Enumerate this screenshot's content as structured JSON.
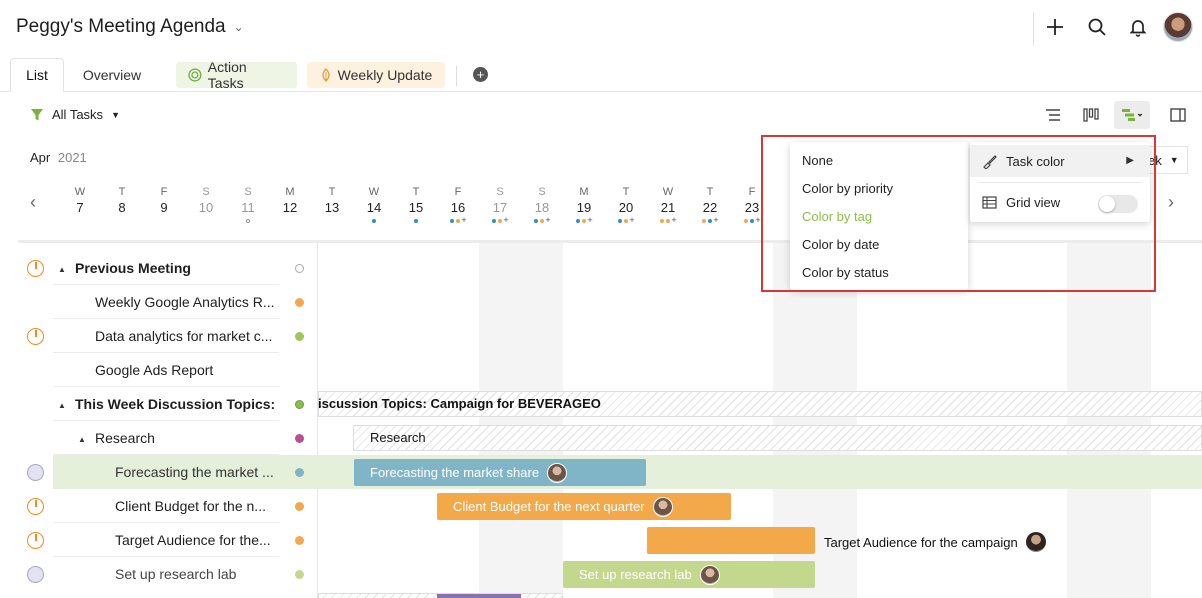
{
  "header": {
    "project_title": "Peggy's Meeting Agenda"
  },
  "tabs": [
    {
      "label": "List"
    },
    {
      "label": "Overview"
    },
    {
      "label": "Action Tasks"
    },
    {
      "label": "Weekly Update"
    }
  ],
  "toolbar": {
    "filter_label": "All Tasks"
  },
  "timeline": {
    "month": "Apr",
    "year": "2021",
    "view_label": "ek",
    "days": [
      {
        "w": "W",
        "d": "7"
      },
      {
        "w": "T",
        "d": "8"
      },
      {
        "w": "F",
        "d": "9"
      },
      {
        "w": "S",
        "d": "10"
      },
      {
        "w": "S",
        "d": "11"
      },
      {
        "w": "M",
        "d": "12"
      },
      {
        "w": "T",
        "d": "13"
      },
      {
        "w": "W",
        "d": "14"
      },
      {
        "w": "T",
        "d": "15"
      },
      {
        "w": "F",
        "d": "16"
      },
      {
        "w": "S",
        "d": "17"
      },
      {
        "w": "S",
        "d": "18"
      },
      {
        "w": "M",
        "d": "19"
      },
      {
        "w": "T",
        "d": "20"
      },
      {
        "w": "W",
        "d": "21"
      },
      {
        "w": "T",
        "d": "22"
      },
      {
        "w": "F",
        "d": "23"
      }
    ]
  },
  "tasks": [
    {
      "label": "Previous Meeting"
    },
    {
      "label": "Weekly Google Analytics R..."
    },
    {
      "label": "Data analytics for market c..."
    },
    {
      "label": "Google Ads Report"
    },
    {
      "label": "This Week Discussion Topics:..."
    },
    {
      "label": "Research"
    },
    {
      "label": "Forecasting the market ..."
    },
    {
      "label": "Client Budget for the n..."
    },
    {
      "label": "Target Audience for the..."
    },
    {
      "label": "Set up research lab"
    }
  ],
  "gantt": {
    "group_bar_text": "iscussion Topics: Campaign for BEVERAGEO",
    "research_bar_text": "Research",
    "bar_forecasting": "Forecasting the market share",
    "bar_client_budget": "Client Budget for the next quarter",
    "bar_target_audience": "Target Audience for the campaign",
    "bar_research_lab": "Set up research lab"
  },
  "color_menu": {
    "items": [
      {
        "label": "None"
      },
      {
        "label": "Color by priority"
      },
      {
        "label": "Color by tag",
        "active": true
      },
      {
        "label": "Color by date"
      },
      {
        "label": "Color by status"
      }
    ]
  },
  "settings_menu": {
    "task_color_label": "Task color",
    "grid_view_label": "Grid view",
    "grid_view_on": false
  },
  "colors": {
    "accent_green": "#8bbf4a",
    "bar_blue": "#7fb5c7",
    "bar_orange": "#f3a94a",
    "bar_green": "#c3d88c",
    "highlight_red": "#d93636"
  }
}
